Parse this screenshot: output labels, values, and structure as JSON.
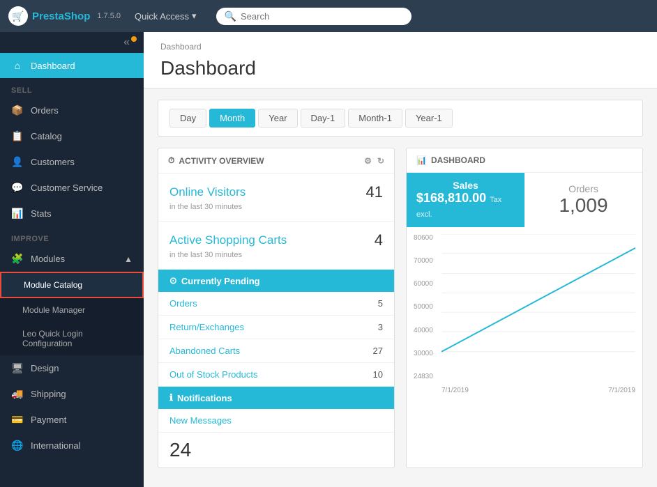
{
  "app": {
    "logo_text_pre": "Presta",
    "logo_text_post": "Shop",
    "version": "1.7.5.0"
  },
  "topnav": {
    "quick_access_label": "Quick Access",
    "search_placeholder": "Search"
  },
  "sidebar": {
    "collapse_icon": "«",
    "dashboard_label": "Dashboard",
    "sell_section": "SELL",
    "orders_label": "Orders",
    "catalog_label": "Catalog",
    "customers_label": "Customers",
    "customer_service_label": "Customer Service",
    "stats_label": "Stats",
    "improve_section": "IMPROVE",
    "modules_label": "Modules",
    "module_catalog_label": "Module Catalog",
    "module_manager_label": "Module Manager",
    "leo_quick_login_label": "Leo Quick Login Configuration",
    "design_label": "Design",
    "shipping_label": "Shipping",
    "payment_label": "Payment",
    "international_label": "International"
  },
  "breadcrumb": "Dashboard",
  "page_title": "Dashboard",
  "date_filter": {
    "buttons": [
      "Day",
      "Month",
      "Year",
      "Day-1",
      "Month-1",
      "Year-1"
    ],
    "active": "Month"
  },
  "activity_overview": {
    "title": "ACTIVITY OVERVIEW",
    "online_visitors_label": "Online Visitors",
    "online_visitors_sub": "in the last 30 minutes",
    "online_visitors_value": "41",
    "active_carts_label": "Active Shopping Carts",
    "active_carts_sub": "in the last 30 minutes",
    "active_carts_value": "4",
    "currently_pending_label": "Currently Pending",
    "pending_icon": "⊙",
    "orders_label": "Orders",
    "orders_value": "5",
    "returns_label": "Return/Exchanges",
    "returns_value": "3",
    "abandoned_label": "Abandoned Carts",
    "abandoned_value": "27",
    "out_of_stock_label": "Out of Stock Products",
    "out_of_stock_value": "10",
    "notifications_label": "Notifications",
    "notif_icon": "ℹ",
    "new_messages_label": "New Messages",
    "messages_count": "24"
  },
  "dashboard_panel": {
    "title": "DASHBOARD",
    "sales_label": "Sales",
    "sales_value": "$168,810.00",
    "sales_sub": "Tax excl.",
    "orders_label": "Orders",
    "orders_value": "1,009"
  },
  "chart": {
    "y_labels": [
      "80600",
      "70000",
      "60000",
      "50000",
      "40000",
      "30000",
      "24830"
    ],
    "x_labels": [
      "7/1/2019",
      "7/1/2019"
    ],
    "line_color": "#25b9d7"
  }
}
